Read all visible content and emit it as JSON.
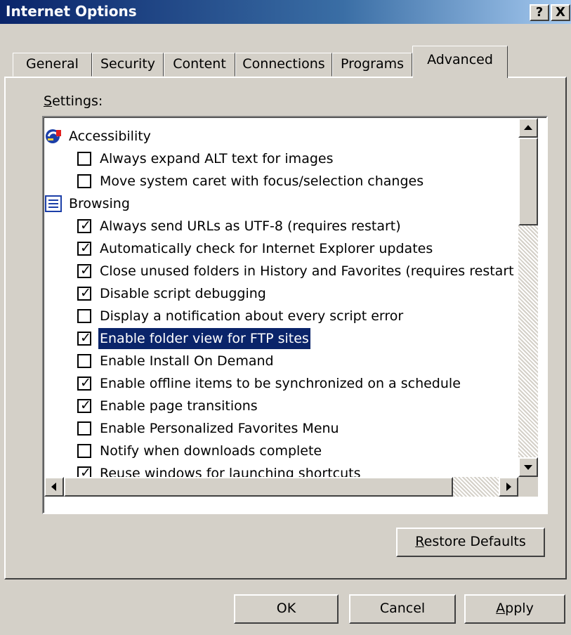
{
  "window": {
    "title": "Internet Options",
    "help_label": "?",
    "close_label": "X"
  },
  "tabs": [
    "General",
    "Security",
    "Content",
    "Connections",
    "Programs",
    "Advanced"
  ],
  "active_tab": "Advanced",
  "settings": {
    "label_first": "S",
    "label_rest": "ettings:",
    "categories": [
      {
        "label": "Accessibility",
        "icon": "accessibility-icon"
      },
      {
        "label": "Browsing",
        "icon": "browsing-icon"
      }
    ],
    "options": [
      {
        "label": "Always expand ALT text for images",
        "checked": false
      },
      {
        "label": "Move system caret with focus/selection changes",
        "checked": false
      },
      {
        "label": "Always send URLs as UTF-8 (requires restart)",
        "checked": true
      },
      {
        "label": "Automatically check for Internet Explorer updates",
        "checked": true
      },
      {
        "label": "Close unused folders in History and Favorites (requires restart",
        "checked": true
      },
      {
        "label": "Disable script debugging",
        "checked": true
      },
      {
        "label": "Display a notification about every script error",
        "checked": false
      },
      {
        "label": "Enable folder view for FTP sites",
        "checked": true,
        "selected": true
      },
      {
        "label": "Enable Install On Demand",
        "checked": false
      },
      {
        "label": "Enable offline items to be synchronized on a schedule",
        "checked": true
      },
      {
        "label": "Enable page transitions",
        "checked": true
      },
      {
        "label": "Enable Personalized Favorites Menu",
        "checked": false
      },
      {
        "label": "Notify when downloads complete",
        "checked": false
      },
      {
        "label": "Reuse windows for launching shortcuts",
        "checked": true
      }
    ]
  },
  "buttons": {
    "restore_first": "R",
    "restore_rest": "estore Defaults",
    "ok": "OK",
    "cancel": "Cancel",
    "apply_first": "A",
    "apply_rest": "pply"
  },
  "colors": {
    "face": "#d4d0c8",
    "title_start": "#0a246a",
    "title_end": "#a6caf0",
    "selection": "#0a246a"
  },
  "tick_glyph": "✓"
}
